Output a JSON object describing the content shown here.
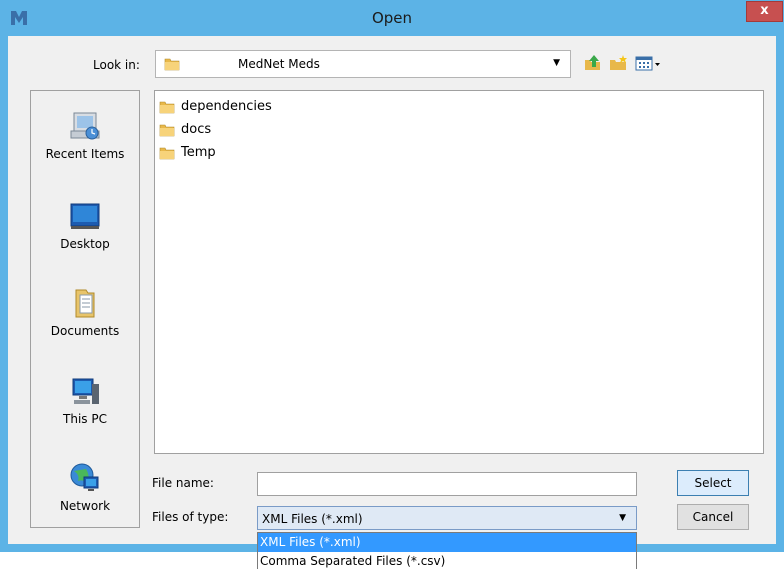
{
  "window": {
    "title": "Open",
    "close_glyph": "x"
  },
  "toolbar": {
    "look_in_label": "Look in:",
    "look_in_value": "MedNet Meds",
    "buttons": [
      "up-one-level-icon",
      "new-folder-icon",
      "view-menu-icon"
    ]
  },
  "places": [
    {
      "label": "Recent Items",
      "icon": "recent-items-icon"
    },
    {
      "label": "Desktop",
      "icon": "desktop-icon"
    },
    {
      "label": "Documents",
      "icon": "documents-icon"
    },
    {
      "label": "This PC",
      "icon": "this-pc-icon"
    },
    {
      "label": "Network",
      "icon": "network-icon"
    }
  ],
  "files": [
    {
      "name": "dependencies",
      "icon": "folder-icon"
    },
    {
      "name": "docs",
      "icon": "folder-icon"
    },
    {
      "name": "Temp",
      "icon": "folder-icon"
    }
  ],
  "form": {
    "file_name_label": "File name:",
    "file_name_value": "",
    "file_type_label": "Files of type:",
    "file_type_value": "XML Files (*.xml)"
  },
  "buttons": {
    "select": "Select",
    "cancel": "Cancel"
  },
  "dropdown": {
    "options": [
      "XML Files (*.xml)",
      "Comma Separated Files (*.csv)"
    ],
    "selected_index": 0
  },
  "colors": {
    "titlebar": "#5cb3e6",
    "selection": "#3399ff",
    "close": "#c75050"
  }
}
